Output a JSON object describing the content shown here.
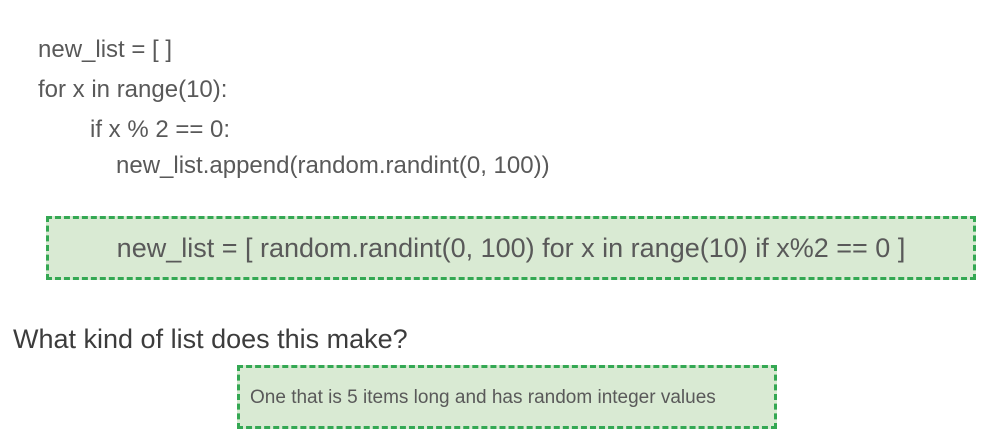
{
  "code": {
    "line1": "new_list = [ ]",
    "line2": "for x in range(10):",
    "line3": "if x % 2 == 0:",
    "line4": "new_list.append(random.randint(0, 100))"
  },
  "comprehension": {
    "text": "new_list = [ random.randint(0, 100) for x in range(10) if x%2 == 0 ]"
  },
  "question": {
    "text": "What kind of list does this make?"
  },
  "answer": {
    "text": "One that is 5 items long and has random integer values"
  },
  "colors": {
    "box_fill": "#d9ead3",
    "box_border": "#34a853",
    "text": "#595959"
  }
}
